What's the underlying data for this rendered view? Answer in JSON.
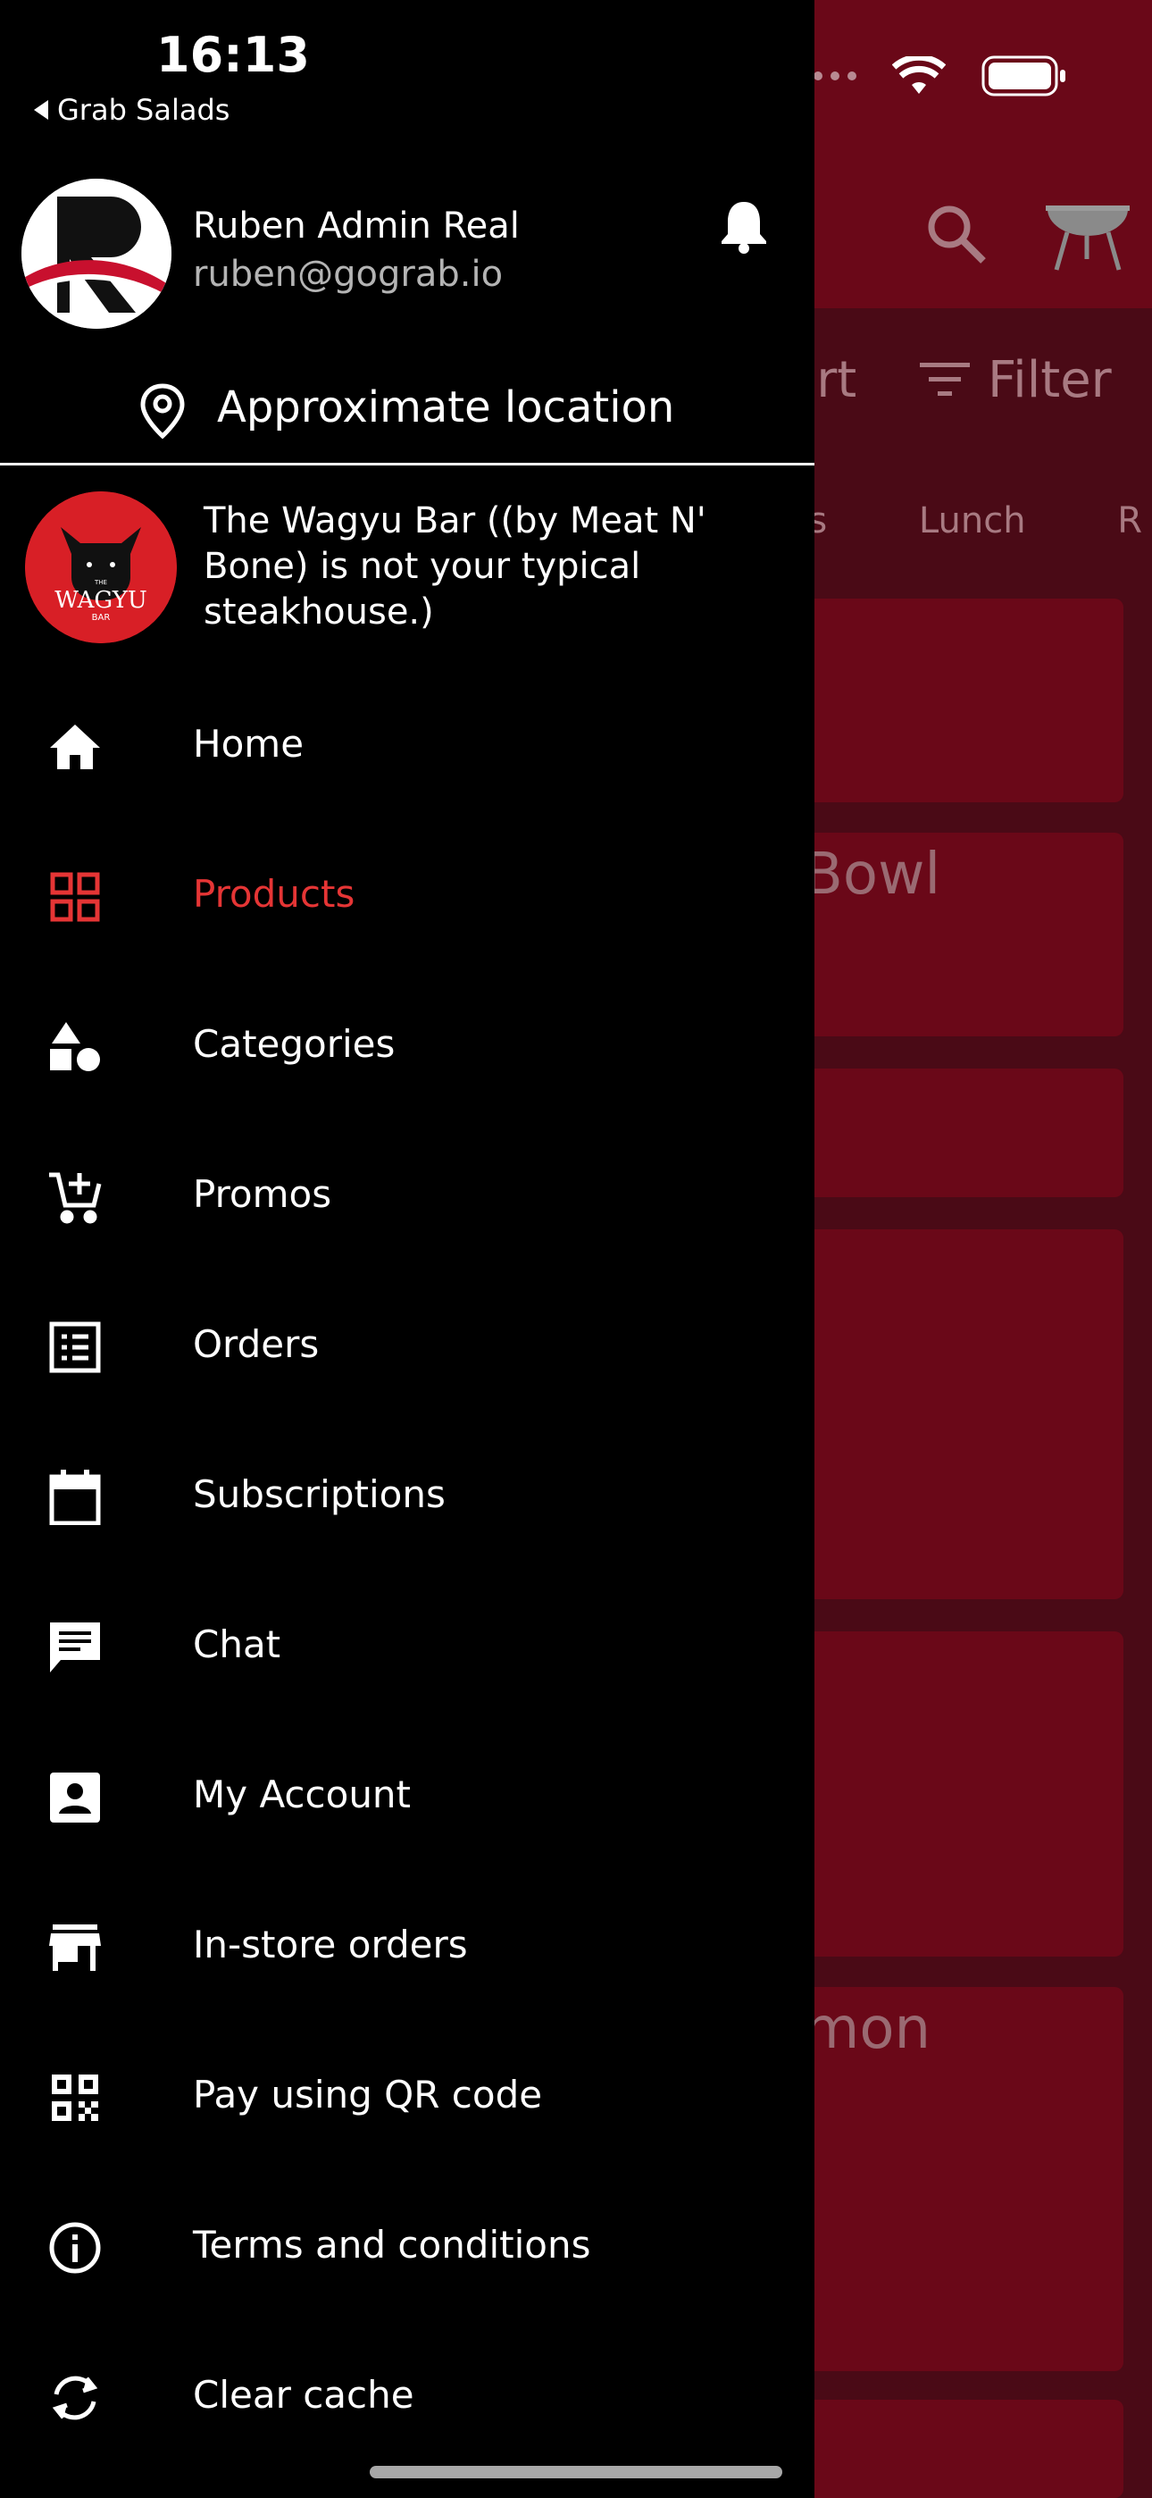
{
  "status_bar": {
    "time": "16:13",
    "back_app": "Grab Salads"
  },
  "background": {
    "sort_label": "ort",
    "filter_label": "Filter",
    "tabs": [
      "us",
      "Lunch",
      "R"
    ],
    "cards": [
      {
        "title": ""
      },
      {
        "title": "Bowl"
      },
      {
        "title": ""
      },
      {
        "title": ""
      },
      {
        "title": ""
      },
      {
        "title": "mon"
      }
    ]
  },
  "profile": {
    "name": "Ruben Admin Real",
    "email": "ruben@gograb.io"
  },
  "location": {
    "label": "Approximate location"
  },
  "store": {
    "logo_text_top": "THE",
    "logo_text": "WAGYU",
    "logo_text_bottom": "BAR",
    "description": "The Wagyu Bar ((by Meat N' Bone) is not your typical steakhouse.)"
  },
  "menu": {
    "items": [
      {
        "label": "Home",
        "icon": "home-icon",
        "active": false
      },
      {
        "label": "Products",
        "icon": "grid-icon",
        "active": true
      },
      {
        "label": "Categories",
        "icon": "shapes-icon",
        "active": false
      },
      {
        "label": "Promos",
        "icon": "cart-plus-icon",
        "active": false
      },
      {
        "label": "Orders",
        "icon": "list-icon",
        "active": false
      },
      {
        "label": "Subscriptions",
        "icon": "calendar-icon",
        "active": false
      },
      {
        "label": "Chat",
        "icon": "chat-icon",
        "active": false
      },
      {
        "label": "My Account",
        "icon": "account-icon",
        "active": false
      },
      {
        "label": "In-store orders",
        "icon": "store-icon",
        "active": false
      },
      {
        "label": "Pay using QR code",
        "icon": "qr-code-icon",
        "active": false
      },
      {
        "label": "Terms and conditions",
        "icon": "info-icon",
        "active": false
      },
      {
        "label": "Clear cache",
        "icon": "refresh-icon",
        "active": false
      }
    ]
  },
  "colors": {
    "accent": "#e53535",
    "drawer_bg": "#000000",
    "app_bar": "#6a0818"
  }
}
